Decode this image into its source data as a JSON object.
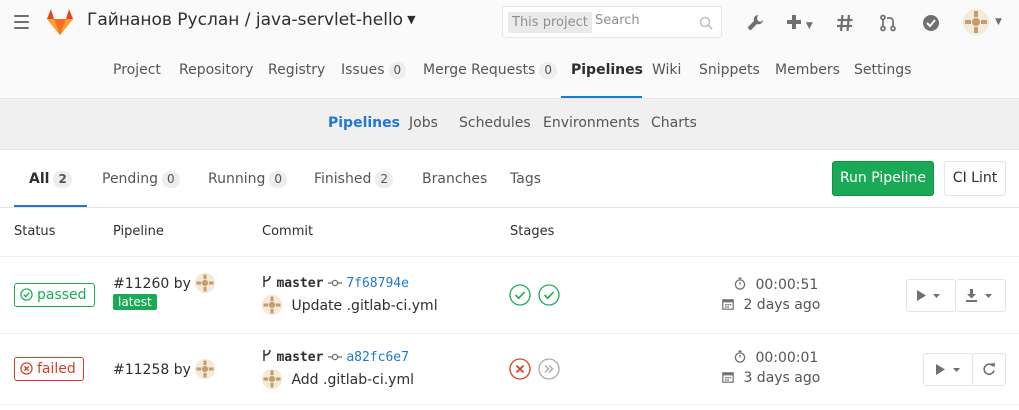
{
  "header": {
    "project_title": "Гайнанов Руслан / java-servlet-hello",
    "search": {
      "scope": "This project",
      "placeholder": "Search"
    },
    "icons": [
      "menu-icon",
      "gitlab-logo",
      "wrench-icon",
      "plus-icon",
      "hash-icon",
      "merge-request-icon",
      "todo-check-icon",
      "user-avatar"
    ]
  },
  "project_nav": {
    "items": [
      {
        "label": "Project"
      },
      {
        "label": "Repository"
      },
      {
        "label": "Registry"
      },
      {
        "label": "Issues",
        "count": "0"
      },
      {
        "label": "Merge Requests",
        "count": "0"
      },
      {
        "label": "Pipelines",
        "active": true
      },
      {
        "label": "Wiki"
      },
      {
        "label": "Snippets"
      },
      {
        "label": "Members"
      },
      {
        "label": "Settings"
      }
    ]
  },
  "sub_nav": {
    "items": [
      {
        "label": "Pipelines",
        "active": true
      },
      {
        "label": "Jobs"
      },
      {
        "label": "Schedules"
      },
      {
        "label": "Environments"
      },
      {
        "label": "Charts"
      }
    ]
  },
  "scope_tabs": {
    "items": [
      {
        "label": "All",
        "count": "2",
        "active": true
      },
      {
        "label": "Pending",
        "count": "0"
      },
      {
        "label": "Running",
        "count": "0"
      },
      {
        "label": "Finished",
        "count": "2"
      },
      {
        "label": "Branches"
      },
      {
        "label": "Tags"
      }
    ],
    "run_pipeline_label": "Run Pipeline",
    "ci_lint_label": "CI Lint"
  },
  "table": {
    "headers": [
      "Status",
      "Pipeline",
      "Commit",
      "Stages"
    ],
    "rows": [
      {
        "status": "passed",
        "pipeline_id": "#11260",
        "by": "by",
        "badge": "latest",
        "branch": "master",
        "sha": "7f68794e",
        "message": "Update .gitlab-ci.yml",
        "stages": [
          "success",
          "success"
        ],
        "duration": "00:00:51",
        "finished": "2 days ago"
      },
      {
        "status": "failed",
        "pipeline_id": "#11258",
        "by": "by",
        "badge": "",
        "branch": "master",
        "sha": "a82fc6e7",
        "message": "Add .gitlab-ci.yml",
        "stages": [
          "failed",
          "skipped"
        ],
        "duration": "00:00:01",
        "finished": "3 days ago"
      }
    ]
  },
  "colors": {
    "accent": "#1f78d1",
    "success": "#1aaa55",
    "danger": "#db3b21",
    "skipped": "#a7a7a7"
  }
}
